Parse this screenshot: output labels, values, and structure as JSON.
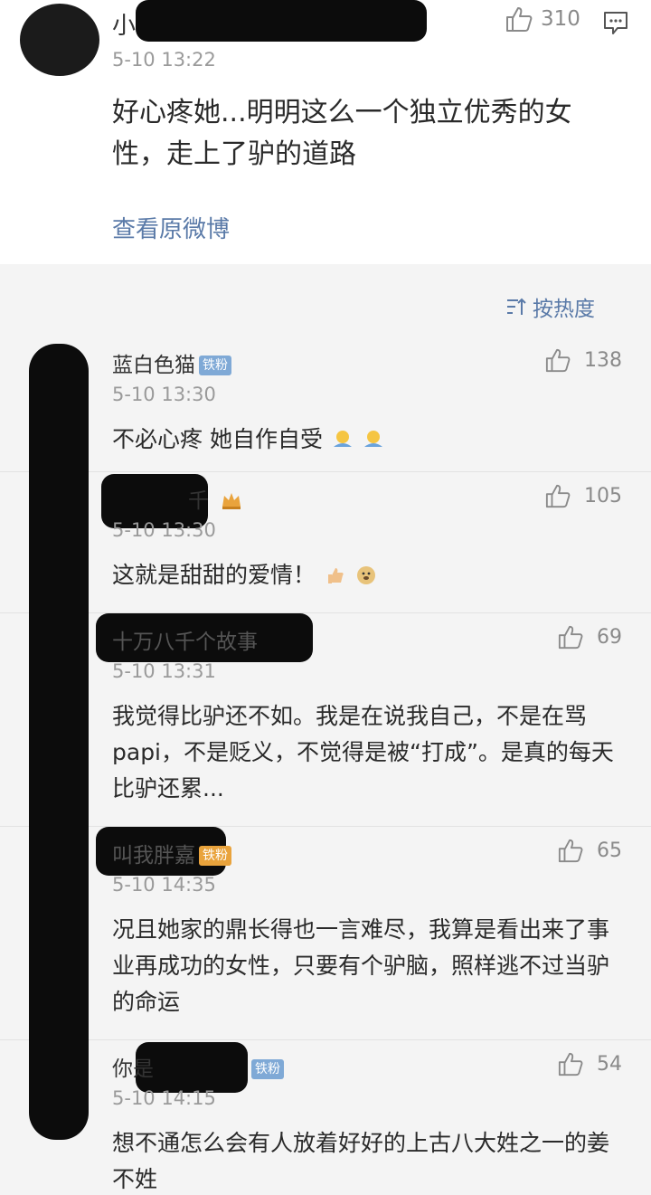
{
  "post": {
    "author": "小",
    "time": "5-10 13:22",
    "likes": "310",
    "text": "好心疼她...明明这么一个独立优秀的女性，走上了驴的道路",
    "source_link": "查看原微博"
  },
  "sort": {
    "label": "按热度"
  },
  "comments": [
    {
      "author": "蓝白色猫",
      "badge": "铁粉",
      "time": "5-10 13:30",
      "likes": "138",
      "text": "不必心疼 她自作自受"
    },
    {
      "author": "千",
      "badge": "",
      "time": "5-10 13:30",
      "likes": "105",
      "text": "这就是甜甜的爱情！"
    },
    {
      "author": "十万八千个故事",
      "badge": "",
      "time": "5-10 13:31",
      "likes": "69",
      "text": "我觉得比驴还不如。我是在说我自己，不是在骂papi，不是贬义，不觉得是被“打成”。是真的每天比驴还累..."
    },
    {
      "author": "叫我胖嘉",
      "badge": "铁粉",
      "time": "5-10 14:35",
      "likes": "65",
      "text": "况且她家的鼎长得也一言难尽，我算是看出来了事业再成功的女性，只要有个驴脑，照样逃不过当驴的命运"
    },
    {
      "author": "你是",
      "badge": "铁粉",
      "time": "5-10 14:15",
      "likes": "54",
      "text": "想不通怎么会有人放着好好的上古八大姓之一的姜不姓"
    }
  ],
  "icons": {
    "like": "thumbs-up-icon",
    "reply": "comment-reply-icon",
    "sort": "sort-icon",
    "crown": "crown-icon"
  },
  "colors": {
    "link": "#5a7aa8",
    "list_background": "#f4f4f4",
    "badge_blue": "#7fa9d6",
    "badge_gold": "#e9a33c"
  }
}
